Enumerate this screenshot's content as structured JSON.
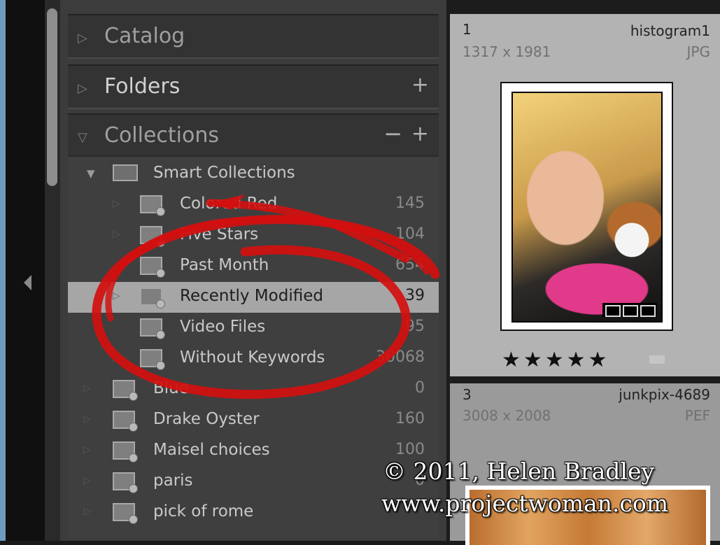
{
  "panels": {
    "catalog": "Catalog",
    "folders": "Folders",
    "folders_add": "+",
    "collections": "Collections",
    "collections_remove": "−",
    "collections_add": "+"
  },
  "collections": {
    "smart_parent": "Smart Collections",
    "items": [
      {
        "label": "Colored Red",
        "count": "145"
      },
      {
        "label": "Five Stars",
        "count": "104"
      },
      {
        "label": "Past Month",
        "count": "654"
      },
      {
        "label": "Recently Modified",
        "count": "39"
      },
      {
        "label": "Video Files",
        "count": "95"
      },
      {
        "label": "Without Keywords",
        "count": "30068"
      }
    ],
    "user": [
      {
        "label": "Blue",
        "count": "0"
      },
      {
        "label": "Drake Oyster",
        "count": "160"
      },
      {
        "label": "Maisel choices",
        "count": "100"
      },
      {
        "label": "paris",
        "count": "0"
      },
      {
        "label": "pick of rome",
        "count": ""
      }
    ]
  },
  "grid": {
    "cell1": {
      "index": "1",
      "dimensions": "1317 x 1981",
      "name": "histogram1",
      "ext": "JPG",
      "rating_stars": "★★★★★"
    },
    "cell2": {
      "index": "3",
      "dimensions": "3008 x 2008",
      "name": "junkpix-4689",
      "ext": "PEF"
    }
  },
  "watermark": {
    "line1": "© 2011, Helen Bradley",
    "line2": "www.projectwoman.com"
  },
  "colors": {
    "selected_row": "#a6a6a6",
    "annotation": "#d40f0f",
    "panel_bg": "#3c3c3c"
  }
}
